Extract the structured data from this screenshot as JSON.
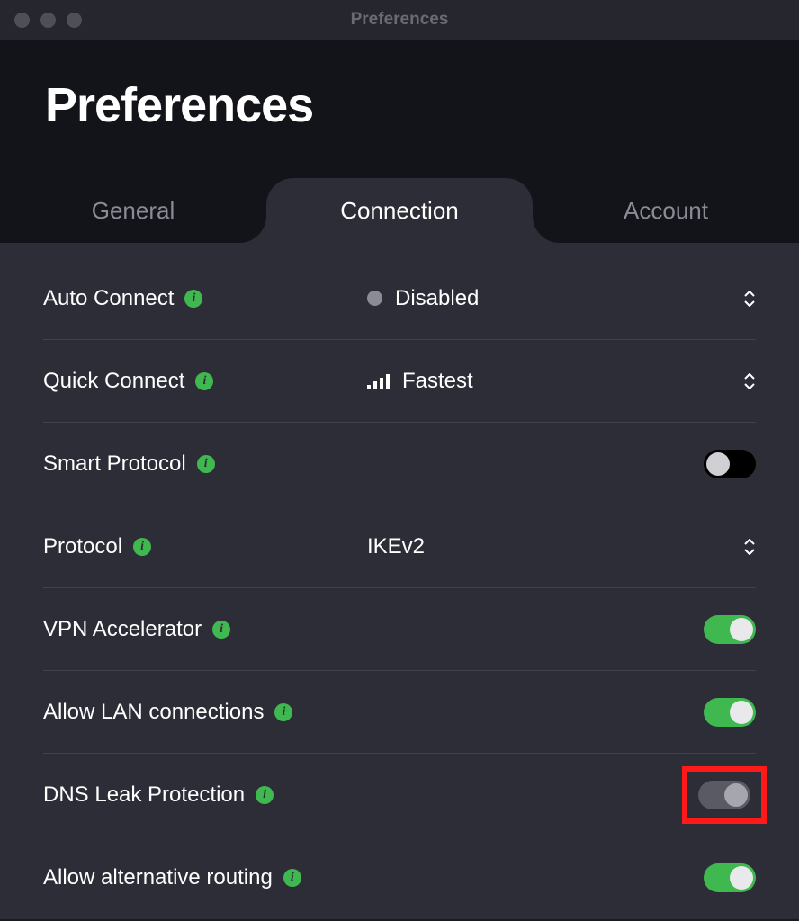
{
  "window": {
    "title": "Preferences"
  },
  "page": {
    "title": "Preferences"
  },
  "tabs": {
    "general": "General",
    "connection": "Connection",
    "account": "Account"
  },
  "rows": {
    "auto_connect": {
      "label": "Auto Connect",
      "value": "Disabled"
    },
    "quick_connect": {
      "label": "Quick Connect",
      "value": "Fastest"
    },
    "smart_protocol": {
      "label": "Smart Protocol"
    },
    "protocol": {
      "label": "Protocol",
      "value": "IKEv2"
    },
    "vpn_accelerator": {
      "label": "VPN Accelerator"
    },
    "allow_lan": {
      "label": "Allow LAN connections"
    },
    "dns_leak": {
      "label": "DNS Leak Protection"
    },
    "alt_routing": {
      "label": "Allow alternative routing"
    }
  },
  "colors": {
    "accent_green": "#3fb94f",
    "bg_dark": "#13131a",
    "bg_panel": "#2d2d37",
    "highlight": "#ff1a1a"
  }
}
